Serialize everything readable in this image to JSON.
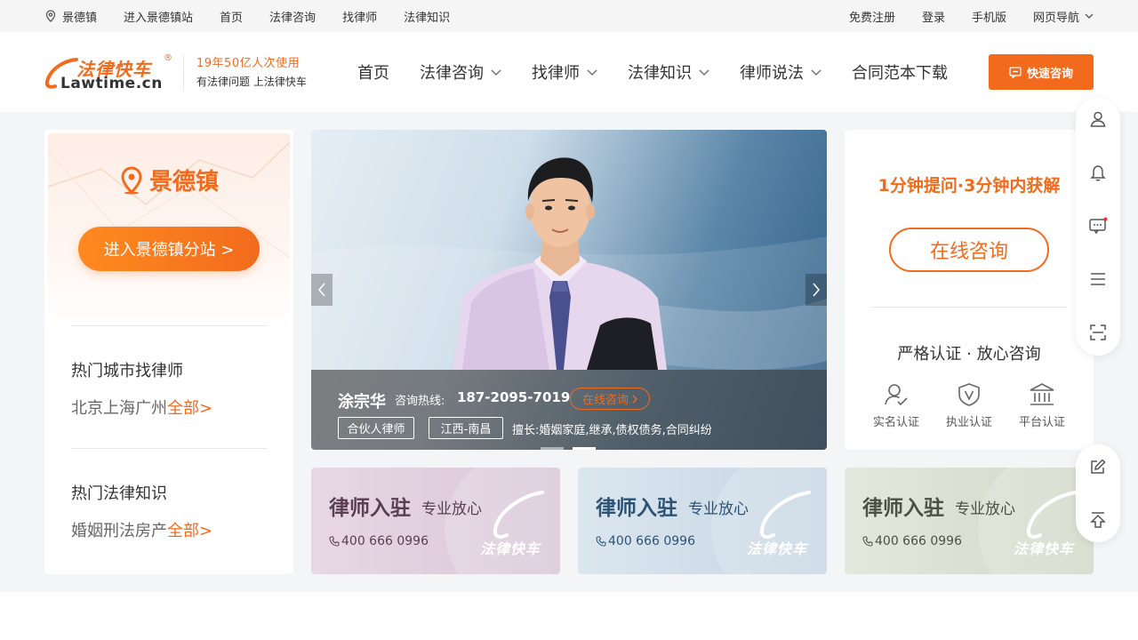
{
  "topbar": {
    "location": "景德镇",
    "enter_station": "进入景德镇站",
    "home": "首页",
    "consult": "法律咨询",
    "find_lawyer": "找律师",
    "knowledge": "法律知识",
    "register": "免费注册",
    "login": "登录",
    "mobile": "手机版",
    "web_nav": "网页导航"
  },
  "header": {
    "logo_cn": "法律快车",
    "logo_en": "Lawtime.cn",
    "logo_reg": "®",
    "slogan_line1": "19年50亿人次使用",
    "slogan_line2": "有法律问题  上法律快车",
    "nav": [
      "首页",
      "法律咨询",
      "找律师",
      "法律知识",
      "律师说法",
      "合同范本下载"
    ],
    "quick_consult": "快速咨询"
  },
  "city_card": {
    "city": "景德镇",
    "enter_btn": "进入景德镇分站 >",
    "hot_city_title": "热门城市找律师",
    "hot_cities": [
      "北京",
      "上海",
      "广州"
    ],
    "all_label": "全部>",
    "hot_knowledge_title": "热门法律知识",
    "hot_topics": [
      "婚姻",
      "刑法",
      "房产"
    ]
  },
  "banner": {
    "lawyer_name": "涂宗华",
    "hotline_label": "咨询热线:",
    "phone": "187-2095-7019",
    "online_btn": "在线咨询",
    "tag_title": "合伙人律师",
    "tag_location": "江西-南昌",
    "specialty": "擅长:婚姻家庭,继承,债权债务,合同纠纷"
  },
  "consult_card": {
    "headline": "1分钟提问·3分钟内获解",
    "online_btn": "在线咨询",
    "subtitle": "严格认证 · 放心咨询",
    "certs": [
      "实名认证",
      "执业认证",
      "平台认证"
    ]
  },
  "promos": [
    {
      "title": "律师入驻",
      "subtitle": "专业放心",
      "phone": "400 666 0996",
      "brand": "法律快车"
    },
    {
      "title": "律师入驻",
      "subtitle": "专业放心",
      "phone": "400 666 0996",
      "brand": "法律快车"
    },
    {
      "title": "律师入驻",
      "subtitle": "专业放心",
      "phone": "400 666 0996",
      "brand": "法律快车"
    }
  ],
  "colors": {
    "brand_orange": "#f26b1d",
    "promo1_bg": "#e3d3df",
    "promo2_bg": "#d3e0ea",
    "promo3_bg": "#dde3d5"
  },
  "icons": {
    "sidebar": [
      "user-icon",
      "bell-icon",
      "message-icon",
      "menu-icon",
      "scan-icon"
    ],
    "sidebar2": [
      "edit-icon",
      "back-to-top-icon"
    ]
  }
}
